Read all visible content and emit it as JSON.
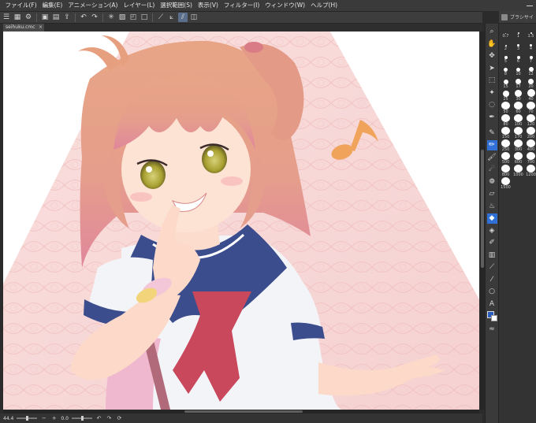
{
  "menu": {
    "items": [
      "ファイル(F)",
      "編集(E)",
      "アニメーション(A)",
      "レイヤー(L)",
      "選択範囲(S)",
      "表示(V)",
      "フィルター(I)",
      "ウィンドウ(W)",
      "ヘルプ(H)"
    ]
  },
  "tab": {
    "filename": "seihuku.cmc",
    "close_glyph": "×"
  },
  "brush_panel": {
    "title": "ブラシサイ",
    "sizes": [
      "0.7",
      "1",
      "1.5",
      "2",
      "3",
      "4",
      "5",
      "6",
      "7",
      "8",
      "10",
      "12",
      "15",
      "17",
      "20",
      "25",
      "30",
      "40",
      "50",
      "60",
      "70",
      "80",
      "100",
      "120",
      "150",
      "170",
      "200",
      "250",
      "300",
      "400",
      "500",
      "600",
      "700",
      "800",
      "1000",
      "1200",
      "1500"
    ]
  },
  "status": {
    "zoom": "44.4",
    "rotation": "0.0"
  },
  "colors": {
    "main": "#2a5bbf",
    "sub": "#ffffff",
    "accent": "#2f6fd6"
  },
  "icons": {
    "commandbar": [
      "hamburger-icon",
      "new-icon",
      "open-icon",
      "save-icon",
      "undo-icon",
      "redo-icon",
      "clear-icon",
      "fill-icon",
      "transform-icon",
      "select-icon",
      "ruler-icon",
      "snap-icon",
      "pen-snap-icon",
      "special-ruler-icon"
    ],
    "tools": [
      "zoom-icon",
      "hand-icon",
      "move-icon",
      "object-icon",
      "select-icon",
      "auto-select-icon",
      "eyedropper-icon",
      "pen-icon",
      "pencil-icon",
      "brush-icon",
      "airbrush-icon",
      "decoration-icon",
      "eraser-icon",
      "blend-icon",
      "fill-icon",
      "gradient-icon",
      "figure-icon",
      "frame-icon",
      "ruler-icon",
      "text-icon",
      "balloon-icon",
      "line-correct-icon"
    ]
  }
}
